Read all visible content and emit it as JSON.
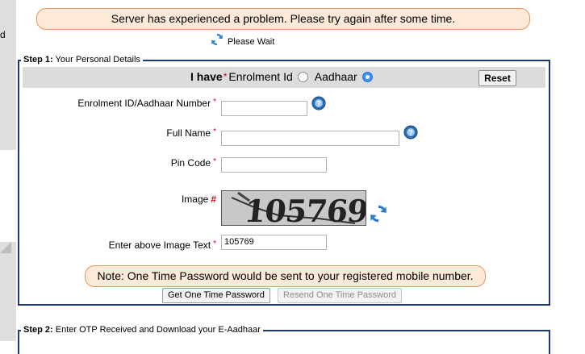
{
  "alert": {
    "message": "Server has experienced a problem. Please try again after some time."
  },
  "loading": {
    "text": "Please Wait",
    "icon": "refresh-icon"
  },
  "step1": {
    "legend_step": "Step 1:",
    "legend_title": "Your Personal Details",
    "band": {
      "i_have": "I have",
      "option_enrolment": "Enrolment Id",
      "option_aadhaar": "Aadhaar",
      "selected": "Aadhaar",
      "reset_label": "Reset"
    },
    "fields": {
      "enrolment_label": "Enrolment ID/Aadhaar Number",
      "enrolment_value": "",
      "fullname_label": "Full Name",
      "fullname_value": "",
      "pincode_label": "Pin Code",
      "pincode_value": "",
      "image_label": "Image",
      "captcha_text": "105769",
      "captcha_input_label": "Enter above Image Text",
      "captcha_input_value": "105769"
    },
    "note": "Note: One Time Password would be sent to your registered mobile number.",
    "get_otp_label": "Get One Time Password",
    "resend_otp_label": "Resend One Time Password"
  },
  "step2": {
    "legend_step": "Step 2:",
    "legend_title": "Enter OTP Received and Download your E-Aadhaar"
  },
  "colors": {
    "accent": "#1c3a7a",
    "alert_bg": "#fde9d7",
    "alert_border": "#e8955b",
    "required": "#d0021b",
    "radio_selected": "#3c8ef3"
  }
}
